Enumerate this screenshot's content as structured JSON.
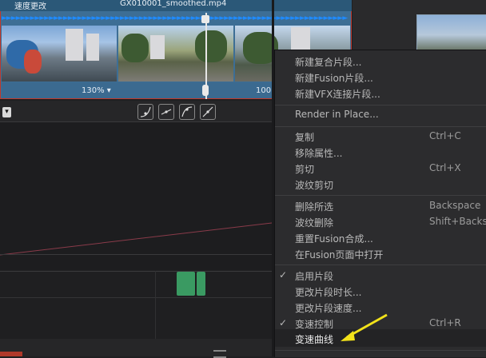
{
  "clip": {
    "speed_label": "速度更改",
    "filename": "GX010001_smoothed.mp4",
    "zoom": "130%",
    "zoom_right": "100"
  },
  "curve_toolbar": {
    "dropdown_glyph": "▾"
  },
  "context_menu": {
    "items": [
      {
        "label": "新建复合片段...",
        "shortcut": "",
        "checked": false
      },
      {
        "label": "新建Fusion片段...",
        "shortcut": "",
        "checked": false
      },
      {
        "label": "新建VFX连接片段...",
        "shortcut": "",
        "checked": false
      },
      {
        "label": "Render in Place...",
        "shortcut": "",
        "checked": false
      },
      {
        "label": "复制",
        "shortcut": "Ctrl+C",
        "checked": false
      },
      {
        "label": "移除属性...",
        "shortcut": "",
        "checked": false
      },
      {
        "label": "剪切",
        "shortcut": "Ctrl+X",
        "checked": false
      },
      {
        "label": "波纹剪切",
        "shortcut": "",
        "checked": false
      },
      {
        "label": "删除所选",
        "shortcut": "Backspace",
        "checked": false
      },
      {
        "label": "波纹删除",
        "shortcut": "Shift+Backsp",
        "checked": false
      },
      {
        "label": "重置Fusion合成...",
        "shortcut": "",
        "checked": false
      },
      {
        "label": "在Fusion页面中打开",
        "shortcut": "",
        "checked": false
      },
      {
        "label": "启用片段",
        "shortcut": "",
        "checked": true
      },
      {
        "label": "更改片段时长...",
        "shortcut": "",
        "checked": false
      },
      {
        "label": "更改片段速度...",
        "shortcut": "",
        "checked": false
      },
      {
        "label": "变速控制",
        "shortcut": "Ctrl+R",
        "checked": true
      },
      {
        "label": "变速曲线",
        "shortcut": "",
        "checked": false
      }
    ]
  },
  "colors": {
    "clip_blue": "#3d6e95",
    "arrow_blue": "#1f8bff",
    "keyframe_green": "#3a9a62",
    "annotation_arrow": "#f2e21a",
    "curve_line": "#8a3b4a"
  }
}
